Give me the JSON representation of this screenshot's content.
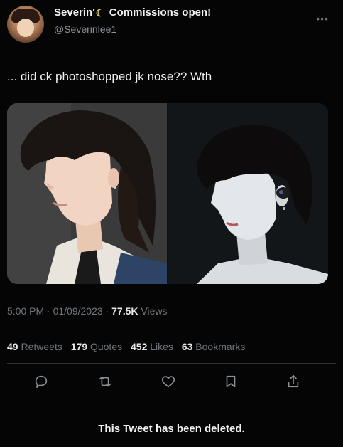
{
  "author": {
    "display_name": "Severin'",
    "moon_icon": "crescent-moon-emoji",
    "display_name_suffix": "Commissions open!",
    "handle": "@Severinlee1"
  },
  "tweet": {
    "text": "... did ck photoshopped jk nose?? Wth"
  },
  "meta": {
    "time": "5:00 PM",
    "date": "01/09/2023",
    "views_count": "77.5K",
    "views_label": "Views"
  },
  "stats": {
    "retweets_count": "49",
    "retweets_label": "Retweets",
    "quotes_count": "179",
    "quotes_label": "Quotes",
    "likes_count": "452",
    "likes_label": "Likes",
    "bookmarks_count": "63",
    "bookmarks_label": "Bookmarks"
  },
  "actions": {
    "icons": [
      "reply-icon",
      "retweet-icon",
      "like-icon",
      "bookmark-icon",
      "share-icon"
    ]
  },
  "footer": {
    "deleted_notice": "This Tweet has been deleted."
  },
  "colors": {
    "background": "#050505",
    "text": "#e7e9ea",
    "muted": "#71767b",
    "divider": "#2f3336"
  }
}
